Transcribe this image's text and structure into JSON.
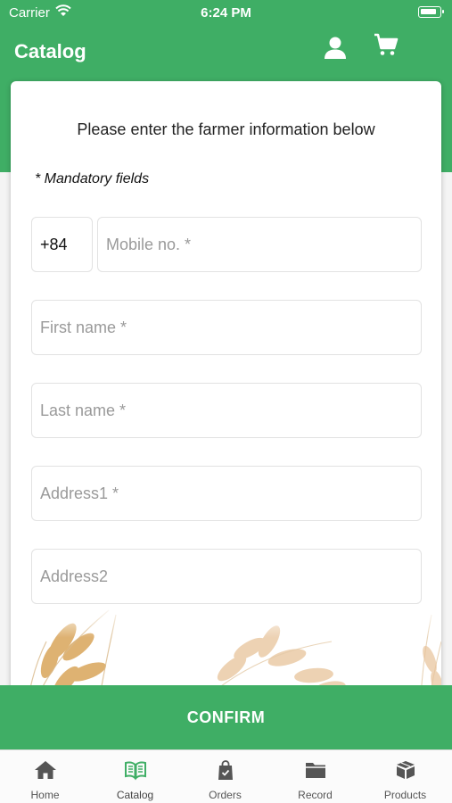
{
  "status_bar": {
    "carrier": "Carrier",
    "time": "6:24 PM"
  },
  "header": {
    "title": "Catalog",
    "user_icon": "user-icon",
    "cart_icon": "cart-icon"
  },
  "form": {
    "instructions": "Please enter the farmer information below",
    "mandatory_note": "* Mandatory fields",
    "country_code": "+84",
    "mobile_placeholder": "Mobile no. *",
    "first_name_placeholder": "First name *",
    "last_name_placeholder": "Last name *",
    "address1_placeholder": "Address1 *",
    "address2_placeholder": "Address2"
  },
  "confirm_label": "CONFIRM",
  "tabs": [
    {
      "label": "Home",
      "icon": "home-icon"
    },
    {
      "label": "Catalog",
      "icon": "catalog-icon",
      "active": true
    },
    {
      "label": "Orders",
      "icon": "orders-icon"
    },
    {
      "label": "Record",
      "icon": "record-icon"
    },
    {
      "label": "Products",
      "icon": "products-icon"
    }
  ],
  "colors": {
    "brand_green": "#3fae65",
    "tab_icon": "#555555",
    "active_tab_icon": "#3fae65"
  }
}
